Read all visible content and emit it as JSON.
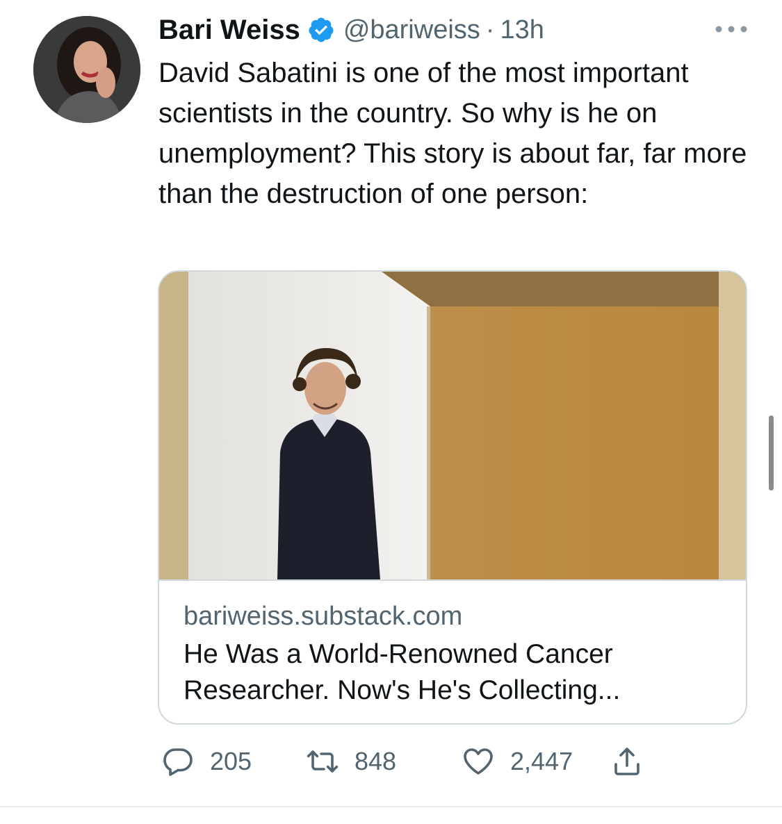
{
  "tweet": {
    "author_name": "Bari Weiss",
    "handle": "@bariweiss",
    "separator": "·",
    "time": "13h",
    "text": "David Sabatini is one of the most important scientists in the country. So why is he on unemployment? This story is about far, far more than the destruction of one person:"
  },
  "card": {
    "domain": "bariweiss.substack.com",
    "title": "He Was a World-Renowned Cancer Researcher. Now's He's Collecting..."
  },
  "actions": {
    "replies": "205",
    "retweets": "848",
    "likes": "2,447"
  },
  "icons": {
    "verified": "verified-badge-icon",
    "more": "more-options-icon",
    "reply": "reply-icon",
    "retweet": "retweet-icon",
    "like": "heart-icon",
    "share": "share-icon"
  },
  "colors": {
    "text_primary": "#0f1419",
    "text_secondary": "#536471",
    "verified_blue": "#1d9bf0",
    "card_border": "#cfd9de"
  }
}
